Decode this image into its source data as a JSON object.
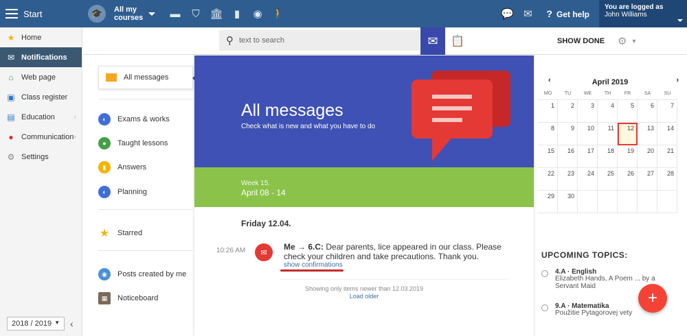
{
  "topbar": {
    "start_label": "Start",
    "courses_line1": "All my",
    "courses_line2": "courses",
    "help_label": "Get help",
    "user_line1": "You are logged as",
    "user_line2": "John Williams",
    "nav_icons": [
      "briefcase-icon",
      "shield-icon",
      "bank-icon",
      "bar-chart-icon",
      "compass-icon",
      "hiker-icon"
    ]
  },
  "leftnav": {
    "items": [
      {
        "label": "Home",
        "icon": "star-icon"
      },
      {
        "label": "Notifications",
        "icon": "envelope-icon"
      },
      {
        "label": "Web page",
        "icon": "house-icon"
      },
      {
        "label": "Class register",
        "icon": "register-icon"
      },
      {
        "label": "Education",
        "icon": "education-icon"
      },
      {
        "label": "Communication",
        "icon": "chat-icon"
      },
      {
        "label": "Settings",
        "icon": "gear-icon"
      }
    ],
    "year": "2018 / 2019"
  },
  "toolbar": {
    "search_placeholder": "text to search",
    "show_done": "SHOW DONE"
  },
  "filters": {
    "all_messages": "All messages",
    "exams": "Exams & works",
    "taught": "Taught lessons",
    "answers": "Answers",
    "planning": "Planning",
    "starred": "Starred",
    "posts": "Posts created by me",
    "noticeboard": "Noticeboard"
  },
  "hero": {
    "title": "All messages",
    "subtitle": "Check what is new and what you have to do"
  },
  "week": {
    "label": "Week 15.",
    "range": "April 08 - 14"
  },
  "feed": {
    "day": "Friday 12.04.",
    "time": "10:26 AM",
    "sender": "Me → 6.C:",
    "text": "Dear parents, lice appeared in our class. Please check your children and take precautions. Thank you.",
    "confirm": "show confirmations",
    "showing": "Showing only items newer than 12.03.2019",
    "load_older": "Load older"
  },
  "calendar": {
    "title": "April 2019",
    "days": [
      "MO",
      "TU",
      "WE",
      "TH",
      "FR",
      "SA",
      "SU"
    ],
    "weeks": [
      [
        "1",
        "2",
        "3",
        "4",
        "5",
        "6",
        "7"
      ],
      [
        "8",
        "9",
        "10",
        "11",
        "12",
        "13",
        "14"
      ],
      [
        "15",
        "16",
        "17",
        "18",
        "19",
        "20",
        "21"
      ],
      [
        "22",
        "23",
        "24",
        "25",
        "26",
        "27",
        "28"
      ],
      [
        "29",
        "30",
        "",
        "",
        "",
        "",
        ""
      ]
    ],
    "today": "12"
  },
  "upcoming": {
    "title": "UPCOMING TOPICS:",
    "topics": [
      {
        "title": "4.A · English",
        "desc": "Elizabeth Hands, A Poem ... by a Servant Maid"
      },
      {
        "title": "9.A · Matematika",
        "desc": "Použitie Pytagorovej vety"
      }
    ]
  },
  "colors": {
    "topbar": "#2f5d8f",
    "hero": "#3f51b5",
    "week": "#8bc34a",
    "accent_red": "#e53935"
  }
}
